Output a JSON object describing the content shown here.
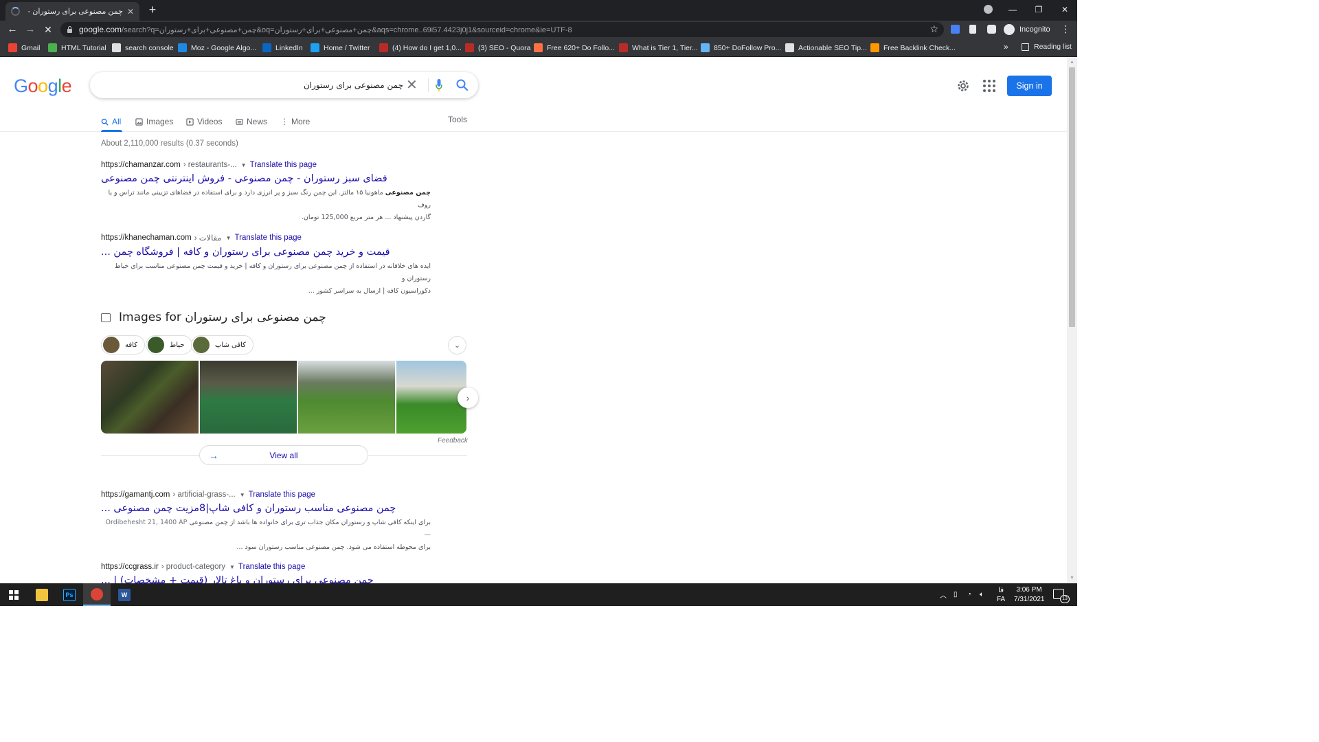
{
  "browser": {
    "tab_title": "چمن مصنوعی برای رستوران - Google Search",
    "new_tab": "+",
    "url_host": "google.com",
    "url_rest": "/search?q=چمن+مصنوعی+برای+رستوران&oq=چمن+مصنوعی+برای+رستوران&aqs=chrome..69i57.4423j0j1&sourceid=chrome&ie=UTF-8",
    "profile_label": "Incognito",
    "bookmarks": [
      {
        "label": "Gmail",
        "color": "#ea4335"
      },
      {
        "label": "HTML Tutorial",
        "color": "#4caf50"
      },
      {
        "label": "search console",
        "color": "#e0e0e0"
      },
      {
        "label": "Moz - Google Algo...",
        "color": "#1e88e5"
      },
      {
        "label": "LinkedIn",
        "color": "#0a66c2"
      },
      {
        "label": "Home / Twitter",
        "color": "#1da1f2"
      },
      {
        "label": "(4) How do I get 1,0...",
        "color": "#b92b27"
      },
      {
        "label": "(3) SEO - Quora",
        "color": "#b92b27"
      },
      {
        "label": "Free 620+ Do Follo...",
        "color": "#ff7043"
      },
      {
        "label": "What is Tier 1, Tier...",
        "color": "#b92b27"
      },
      {
        "label": "850+ DoFollow Pro...",
        "color": "#64b5f6"
      },
      {
        "label": "Actionable SEO Tip...",
        "color": "#e0e0e0"
      },
      {
        "label": "Free Backlink Check...",
        "color": "#ff9800"
      }
    ],
    "reading_list": "Reading list"
  },
  "google": {
    "logo_letters": [
      {
        "ch": "G",
        "color": "#4285f4"
      },
      {
        "ch": "o",
        "color": "#ea4335"
      },
      {
        "ch": "o",
        "color": "#fbbc05"
      },
      {
        "ch": "g",
        "color": "#4285f4"
      },
      {
        "ch": "l",
        "color": "#34a853"
      },
      {
        "ch": "e",
        "color": "#ea4335"
      }
    ],
    "query": "چمن مصنوعی برای رستوران",
    "sign_in": "Sign in",
    "tabs": [
      {
        "label": "All",
        "active": true
      },
      {
        "label": "Images",
        "active": false
      },
      {
        "label": "Videos",
        "active": false
      },
      {
        "label": "News",
        "active": false
      },
      {
        "label": "More",
        "active": false
      }
    ],
    "tools": "Tools",
    "stats": "About 2,110,000 results (0.37 seconds)",
    "translate_label": "Translate this page",
    "results": [
      {
        "host": "https://chamanzar.com",
        "path": "› restaurants-...",
        "title": "فضای سبز رستوران - چمن مصنوعی - فروش اینترنتی چمن مصنوعی",
        "snippet_line1_bold": "چمن مصنوعی",
        "snippet_line1": " ماهونیا ۱۵ مالتز. این چمن رنگ سبز و پر انرژی دارد و برای استفاده در فضاهای تزیینی مانند تراس و یا روف",
        "snippet_line2": "گاردن پیشنهاد ... هر متر مربع 125,000 تومان."
      },
      {
        "host": "https://khanechaman.com",
        "path": "› مقالات",
        "title": "قیمت و خرید چمن مصنوعی برای رستوران و کافه | فروشگاه چمن ...",
        "snippet_line1": "ایده های خلاقانه در استفاده از چمن مصنوعی برای رستوران و کافه | خرید و قیمت چمن مصنوعی مناسب برای حیاط رستوران و",
        "snippet_line2": "دکوراسیون کافه | ارسال به سراسر کشور ..."
      },
      {
        "host": "https://gamantj.com",
        "path": "› artificial-grass-...",
        "title": "چمن مصنوعی مناسب رستوران و کافی شاپ|8مزیت چمن مصنوعی ...",
        "snippet_date": "Ordibehesht 21, 1400 AP —",
        "snippet_line1": "برای اینکه کافی شاپ و رستوران مکان جذاب تری برای خانواده ها باشد از چمن مصنوعی",
        "snippet_line2": "برای محوطه استفاده می شود. چمن مصنوعی مناسب رستوران سود ..."
      },
      {
        "host": "https://ccgrass.ir",
        "path": "› product-category",
        "title": "چمن مصنوعی برای رستوران و باغ تالار (قیمت + مشخصات) | ..."
      }
    ],
    "images_heading": "Images for چمن مصنوعی برای رستوران",
    "chips": [
      {
        "label": "کافه",
        "color": "#6a5a3a"
      },
      {
        "label": "حیاط",
        "color": "#3a5a2a"
      },
      {
        "label": "کافی شاپ",
        "color": "#5a6a3a"
      }
    ],
    "feedback": "Feedback",
    "view_all": "View all"
  },
  "taskbar": {
    "lang_top": "فا",
    "lang_bottom": "FA",
    "time": "3:06 PM",
    "date": "7/31/2021",
    "notifications": "13"
  }
}
